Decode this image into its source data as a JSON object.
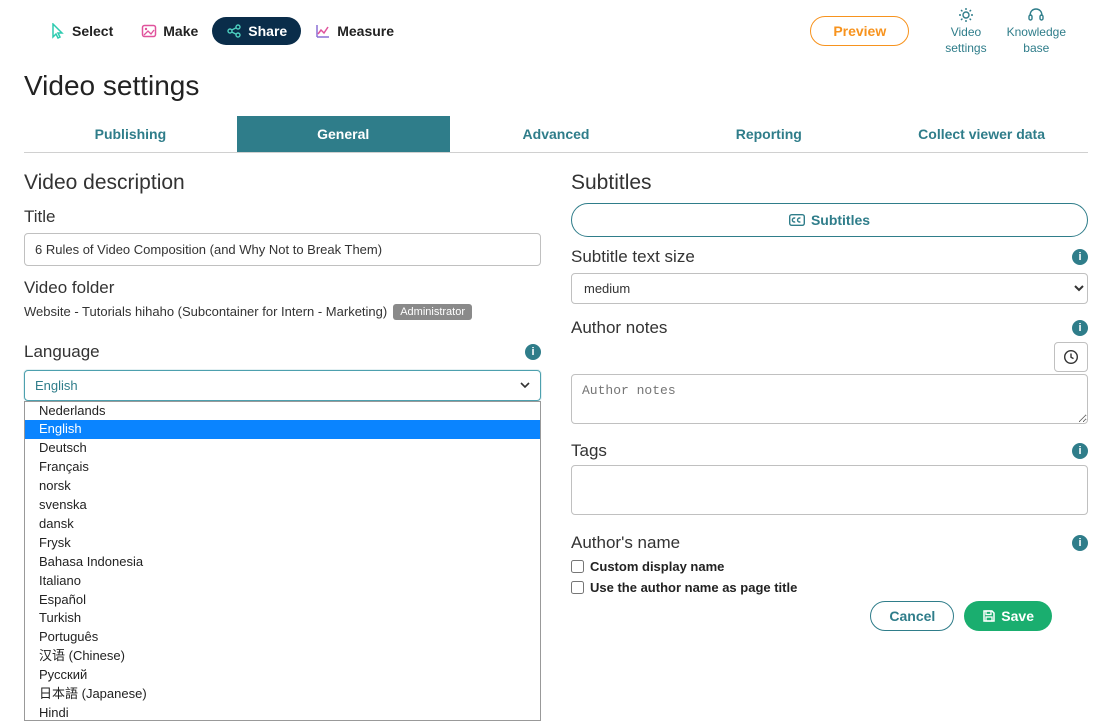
{
  "nav": {
    "select": "Select",
    "make": "Make",
    "share": "Share",
    "measure": "Measure"
  },
  "topright": {
    "preview": "Preview",
    "video_settings_l1": "Video",
    "video_settings_l2": "settings",
    "kb_l1": "Knowledge",
    "kb_l2": "base"
  },
  "page_title": "Video settings",
  "tabs": {
    "publishing": "Publishing",
    "general": "General",
    "advanced": "Advanced",
    "reporting": "Reporting",
    "collect": "Collect viewer data"
  },
  "left": {
    "section_heading": "Video description",
    "title_label": "Title",
    "title_value": "6 Rules of Video Composition (and Why Not to Break Them)",
    "folder_label": "Video folder",
    "folder_value": "Website - Tutorials hihaho (Subcontainer for Intern - Marketing)",
    "folder_badge": "Administrator",
    "language_label": "Language",
    "language_selected": "English",
    "language_options": [
      "Nederlands",
      "English",
      "Deutsch",
      "Français",
      "norsk",
      "svenska",
      "dansk",
      "Frysk",
      "Bahasa Indonesia",
      "Italiano",
      "Español",
      "Turkish",
      "Português",
      "汉语 (Chinese)",
      "Русский",
      "日本語 (Japanese)",
      "Hindi"
    ]
  },
  "right": {
    "section_heading": "Subtitles",
    "subtitles_button": "Subtitles",
    "subtitle_size_label": "Subtitle text size",
    "subtitle_size_value": "medium",
    "author_notes_label": "Author notes",
    "author_notes_placeholder": "Author notes",
    "tags_label": "Tags",
    "author_name_label": "Author's name",
    "cb_custom": "Custom display name",
    "cb_pagetitle": "Use the author name as page title"
  },
  "footer": {
    "cancel": "Cancel",
    "save": "Save"
  }
}
